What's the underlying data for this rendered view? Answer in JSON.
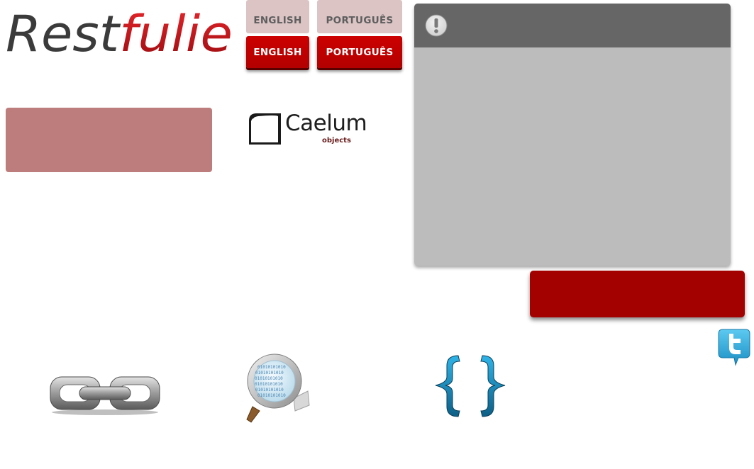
{
  "brand": {
    "logo_text_dark": "Rest",
    "logo_text_red": "fulie"
  },
  "language": {
    "english_label": "ENGLISH",
    "portuguese_label": "PORTUGUÊS"
  },
  "partner": {
    "name": "Caelum",
    "subtitle": "objects"
  },
  "alert": {
    "icon": "exclamation-icon"
  },
  "social": {
    "icon": "twitter-icon"
  },
  "features": {
    "icons": [
      "link-icon",
      "search-icon",
      "braces-icon"
    ]
  },
  "colors": {
    "brand_red": "#cc0000",
    "cta_red": "#a30000",
    "pink_panel": "#bd7d7c",
    "alert_header": "#666666",
    "alert_body": "#bcbcbc",
    "twitter_blue": "#2aa3d8"
  }
}
